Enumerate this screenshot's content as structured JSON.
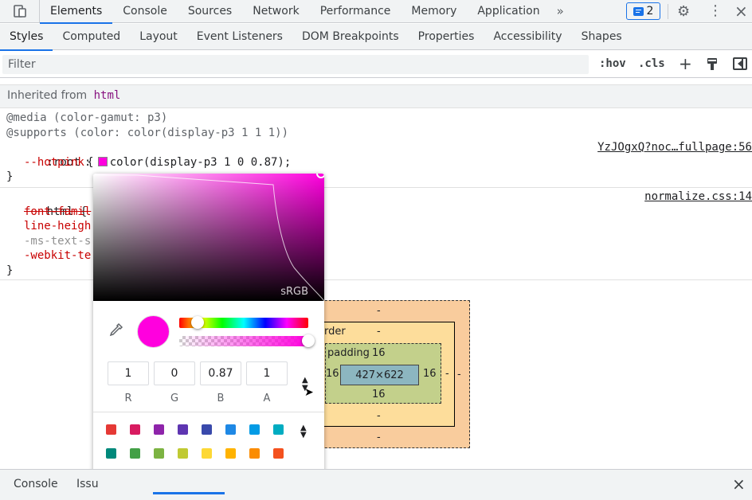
{
  "topbar": {
    "inspect_icon": "device-toolbar-icon",
    "tabs": [
      "Elements",
      "Console",
      "Sources",
      "Network",
      "Performance",
      "Memory",
      "Application"
    ],
    "more": "»",
    "message_count": "2",
    "settings_icon": "gear-icon",
    "menu_icon": "kebab-icon",
    "close_icon": "close-icon"
  },
  "subtabs": [
    "Styles",
    "Computed",
    "Layout",
    "Event Listeners",
    "DOM Breakpoints",
    "Properties",
    "Accessibility",
    "Shapes"
  ],
  "filter": {
    "placeholder": "Filter",
    "hov": ":hov",
    "cls": ".cls",
    "plus": "+"
  },
  "styles": {
    "inherited_label": "Inherited from",
    "inherited_tag": "html",
    "rule1": {
      "media": "@media (color-gamut: p3)",
      "supports": "@supports (color: color(display-p3 1 1 1))",
      "selector": ":root {",
      "prop": "--hotpink",
      "value": "color(display-p3 1 0 0.87);",
      "close": "}",
      "source": "YzJOgxQ?noc…fullpage:56"
    },
    "rule2": {
      "selector": "html {",
      "lines": [
        "font-famil",
        "line-heigh",
        "-ms-text-s",
        "-webkit-te"
      ],
      "close": "}",
      "source": "normalize.css:14"
    }
  },
  "boxmodel": {
    "margin_label": "n",
    "border_label": "rder",
    "padding_label": "padding",
    "content": "427×622",
    "dash": "-",
    "padding_top": "16",
    "padding_left": "16",
    "padding_right": "16",
    "padding_bottom": "16"
  },
  "colorpicker": {
    "gamut_label": "sRGB",
    "current_color": "#ff00de",
    "channels": [
      {
        "value": "1",
        "label": "R"
      },
      {
        "value": "0",
        "label": "G"
      },
      {
        "value": "0.87",
        "label": "B"
      },
      {
        "value": "1",
        "label": "A"
      }
    ],
    "hue_position": 0.14,
    "alpha_level": 1.0,
    "palette": [
      "#e53935",
      "#d81b60",
      "#8e24aa",
      "#5e35b1",
      "#3949ab",
      "#1e88e5",
      "#039be5",
      "#00acc1",
      "#00897b",
      "#43a047",
      "#7cb342",
      "#c0ca33",
      "#fdd835",
      "#ffb300",
      "#fb8c00",
      "#f4511e",
      "#6d4c41",
      "#757575",
      "#546e7a"
    ]
  },
  "drawer": {
    "tabs": [
      "Console",
      "Issu"
    ],
    "close_icon": "close-icon"
  }
}
